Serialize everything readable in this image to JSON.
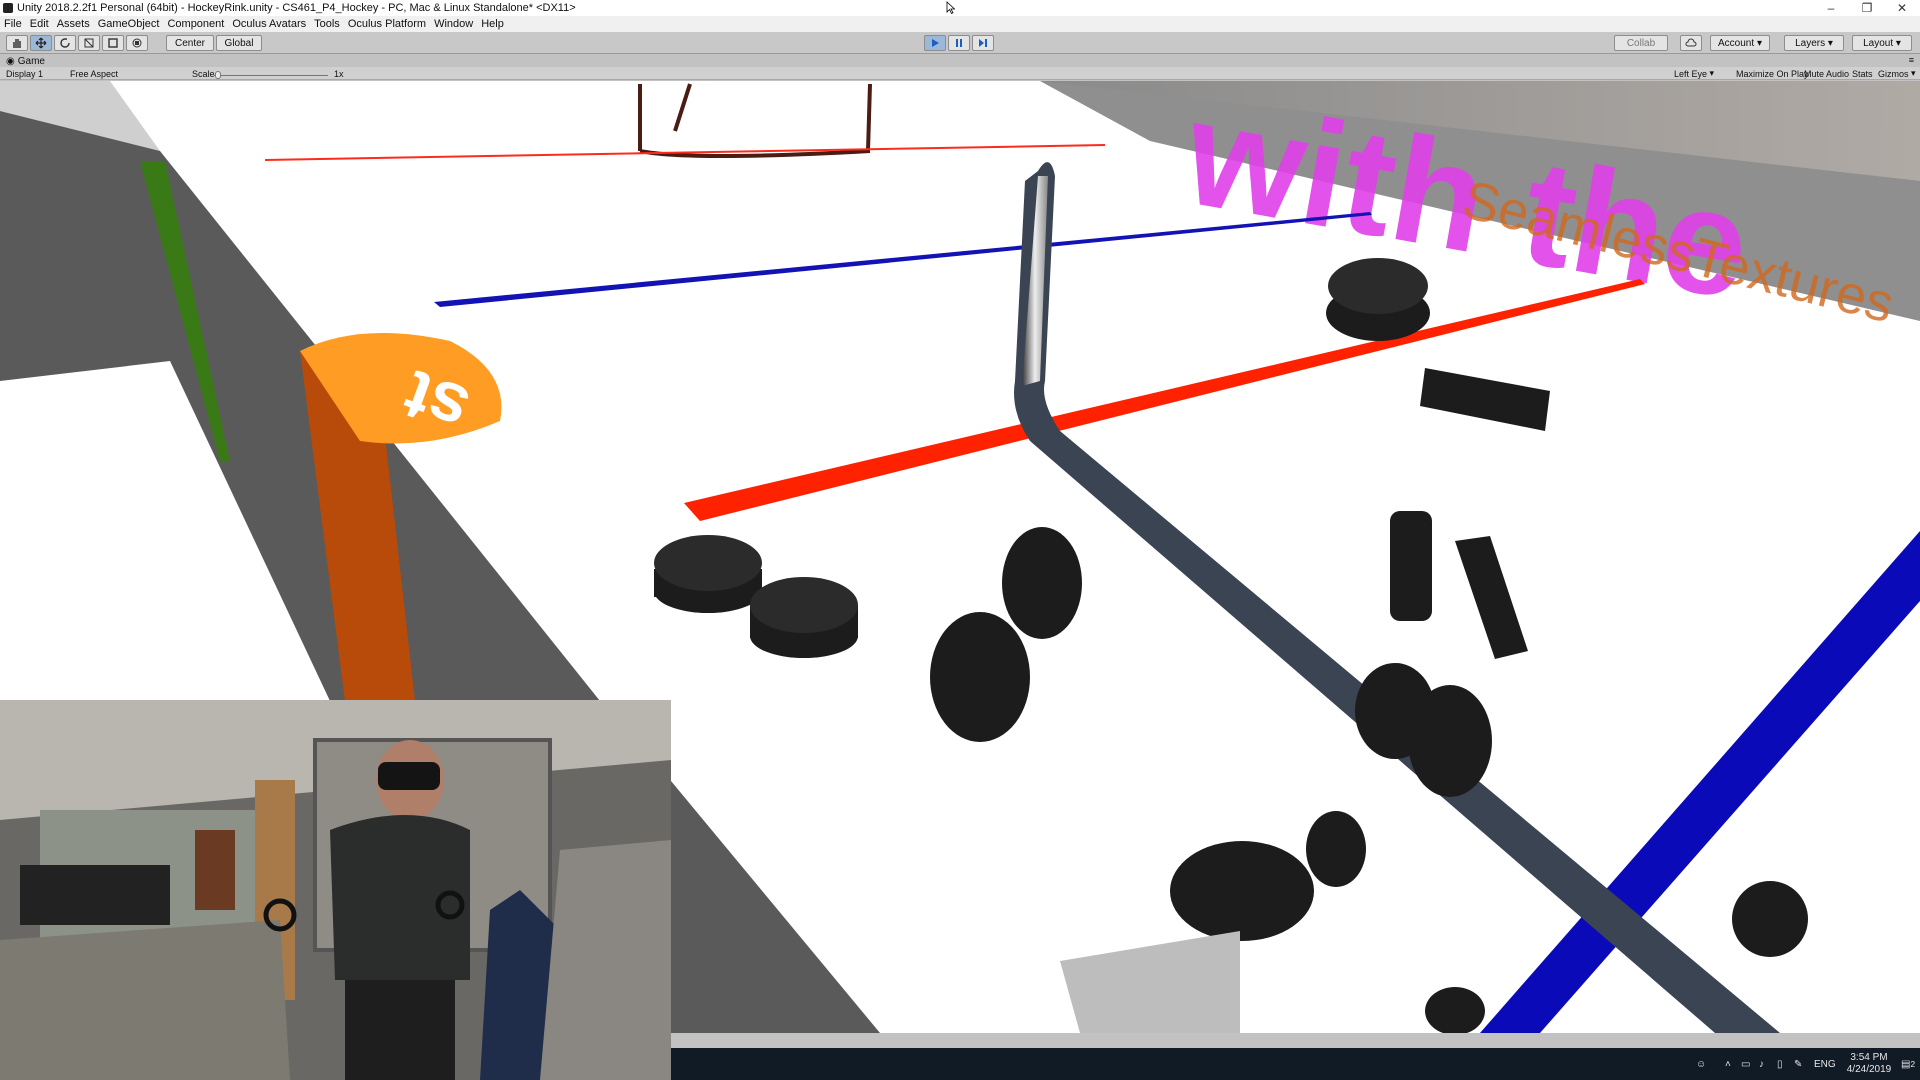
{
  "window": {
    "title": "Unity 2018.2.2f1 Personal (64bit) - HockeyRink.unity - CS461_P4_Hockey - PC, Mac & Linux Standalone* <DX11>",
    "controls": [
      "–",
      "❐",
      "✕"
    ]
  },
  "menu": [
    "File",
    "Edit",
    "Assets",
    "GameObject",
    "Component",
    "Oculus Avatars",
    "Tools",
    "Oculus Platform",
    "Window",
    "Help"
  ],
  "toolbar": {
    "tools": [
      "hand-icon",
      "move-icon",
      "rotate-icon",
      "scale-icon",
      "rect-icon",
      "transform-icon"
    ],
    "pivot": "Center",
    "space": "Global",
    "play_state": "playing",
    "collab": "Collab",
    "account": "Account",
    "layers": "Layers",
    "layout": "Layout"
  },
  "game_view": {
    "tab_label": "Game",
    "display": "Display 1",
    "aspect": "Free Aspect",
    "scale_label": "Scale",
    "scale_value": "1x",
    "eye": "Left Eye",
    "maximize": "Maximize On Play",
    "mute": "Mute Audio",
    "stats": "Stats",
    "gizmos": "Gizmos"
  },
  "scene": {
    "board_ad_text": "with the",
    "board_brand": "SeamlessTextures",
    "board_sign": "st"
  },
  "taskbar": {
    "lang": "ENG",
    "time": "3:54 PM",
    "date": "4/24/2019",
    "notifications": "2"
  }
}
